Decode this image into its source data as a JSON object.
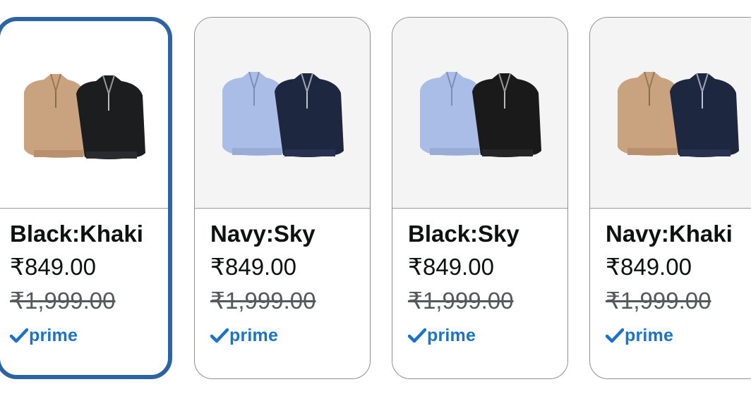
{
  "variants": [
    {
      "name": "Black:Khaki",
      "price": "₹849.00",
      "list_price": "₹1,999.00",
      "badge": "prime",
      "selected": true,
      "colors": {
        "left": "#c9a27f",
        "right": "#1c1d1f"
      }
    },
    {
      "name": "Navy:Sky",
      "price": "₹849.00",
      "list_price": "₹1,999.00",
      "badge": "prime",
      "selected": false,
      "colors": {
        "left": "#a9bde6",
        "right": "#1e2740"
      }
    },
    {
      "name": "Black:Sky",
      "price": "₹849.00",
      "list_price": "₹1,999.00",
      "badge": "prime",
      "selected": false,
      "colors": {
        "left": "#a9bde6",
        "right": "#1a1a1a"
      }
    },
    {
      "name": "Navy:Khaki",
      "price": "₹849.00",
      "list_price": "₹1,999.00",
      "badge": "prime",
      "selected": false,
      "colors": {
        "left": "#c9a27f",
        "right": "#1e2740"
      }
    }
  ],
  "theme": {
    "selected_border": "#2b64a0",
    "prime_blue": "#1a73c8"
  }
}
